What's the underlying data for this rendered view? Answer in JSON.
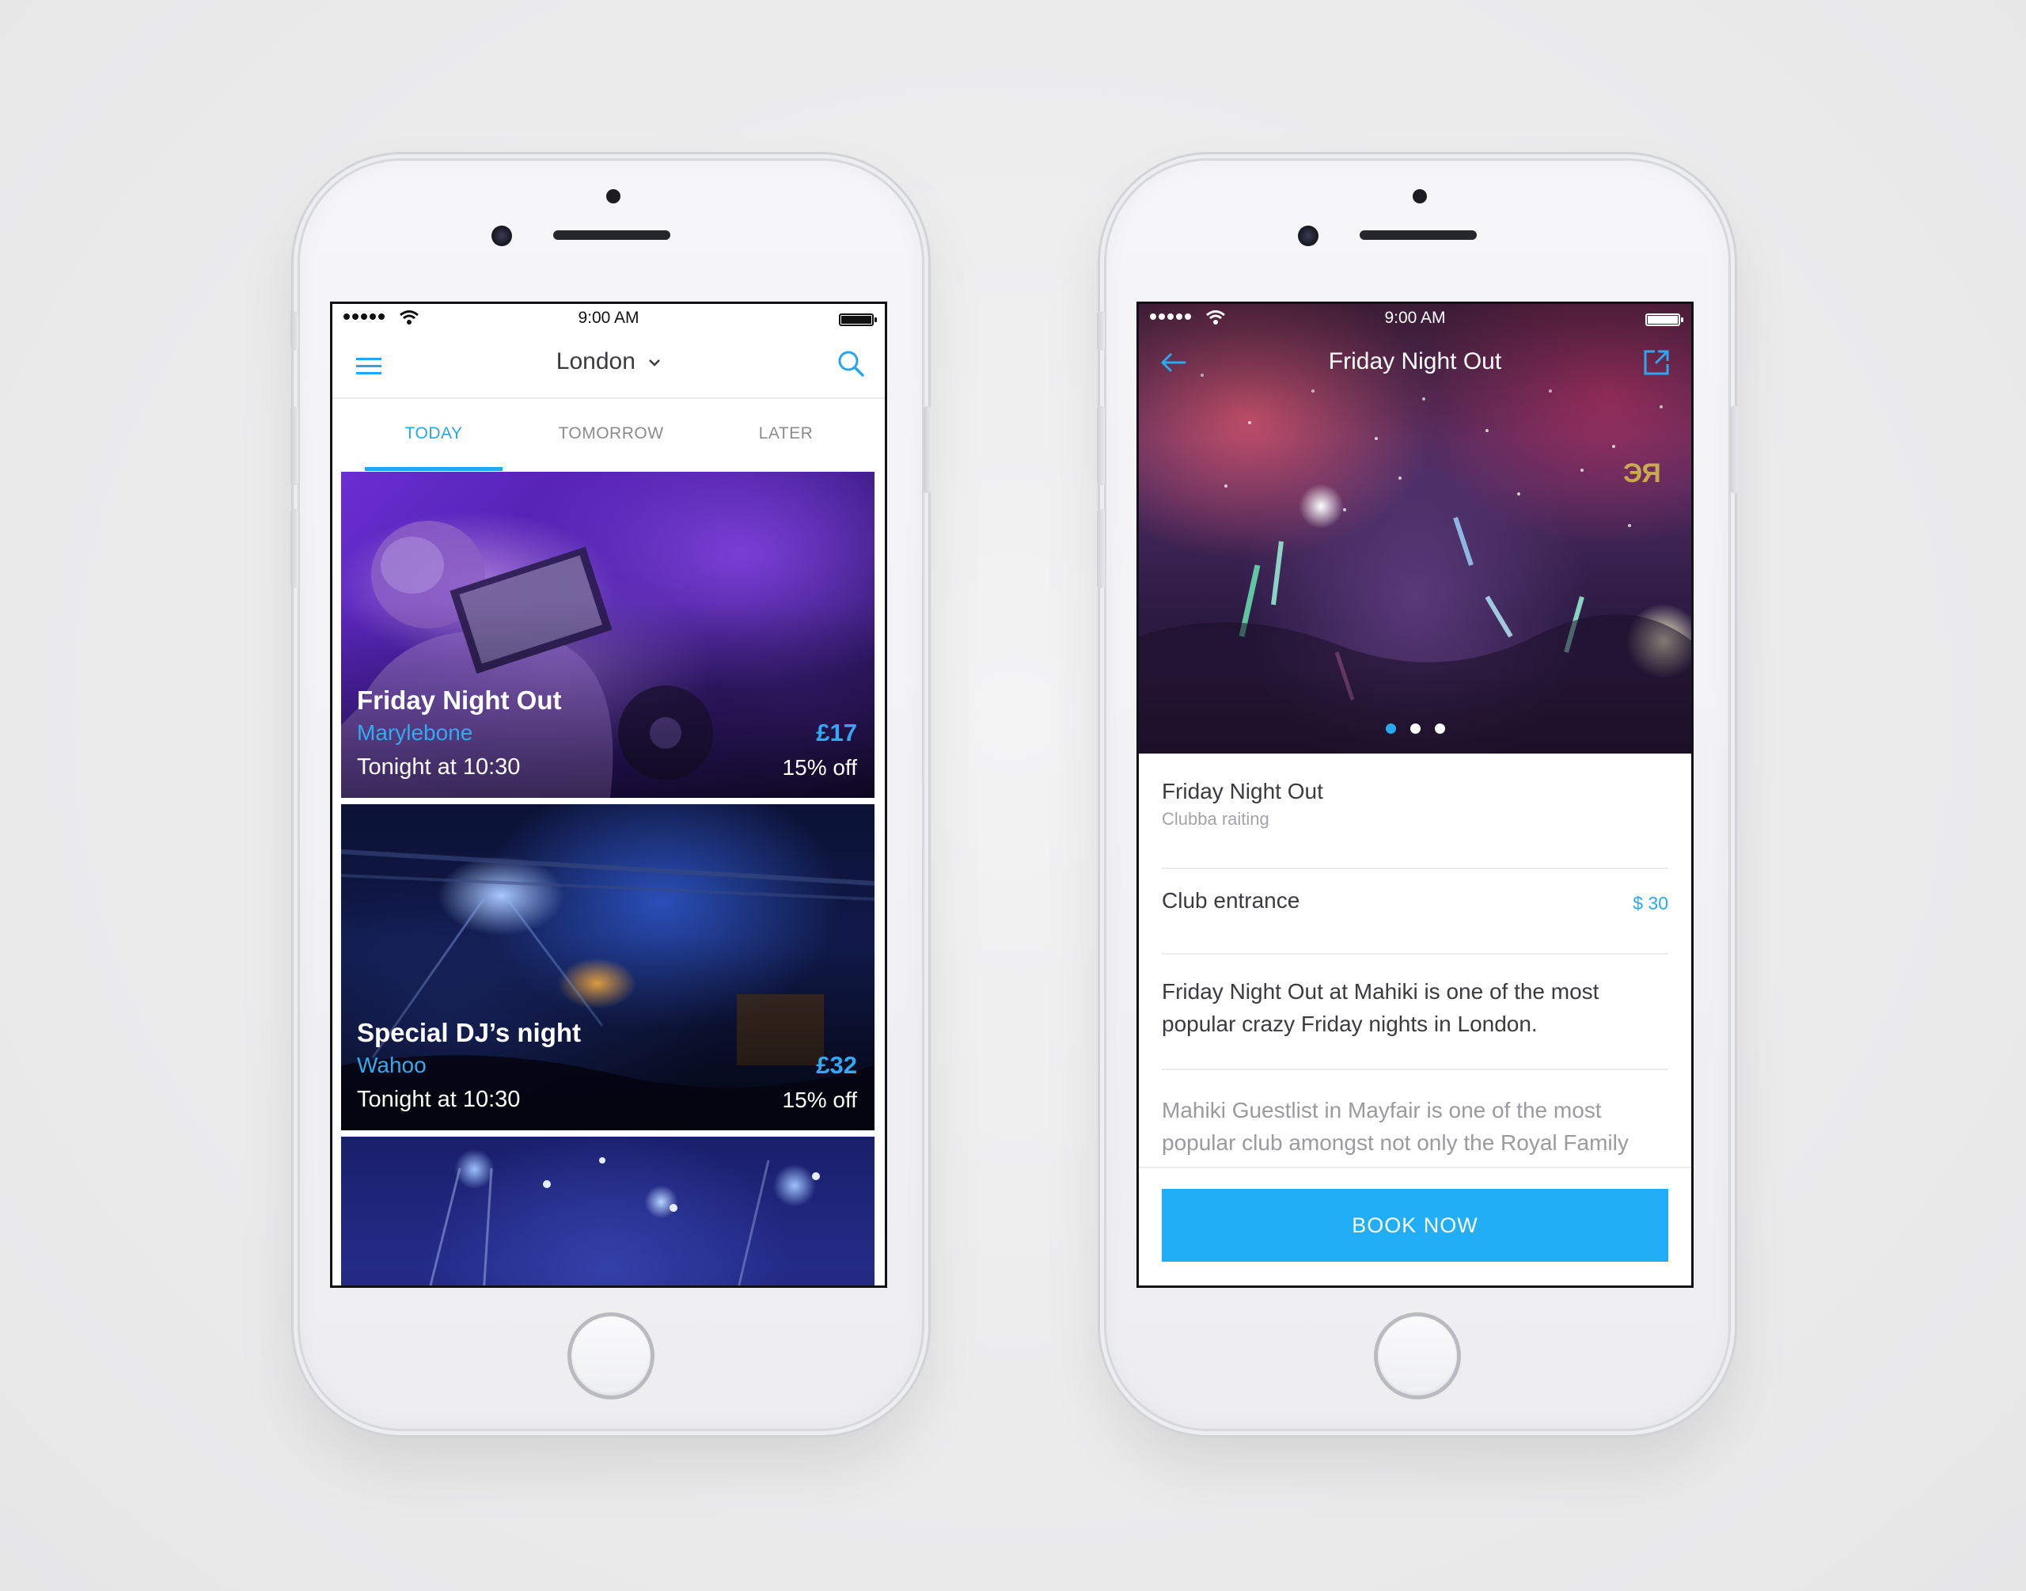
{
  "colors": {
    "accent": "#25a6ee",
    "button": "#22aef7",
    "text_dark": "#3a3b40",
    "text_muted": "#9a9ba1"
  },
  "status_bar": {
    "time": "9:00 AM"
  },
  "list_screen": {
    "city": "London",
    "icons": {
      "menu": "hamburger-menu-icon",
      "dropdown": "chevron-down-icon",
      "search": "search-icon"
    },
    "tabs": [
      {
        "label": "TODAY",
        "active": true
      },
      {
        "label": "TOMORROW",
        "active": false
      },
      {
        "label": "LATER",
        "active": false
      }
    ],
    "events": [
      {
        "title": "Friday Night Out",
        "venue": "Marylebone",
        "time": "Tonight at 10:30",
        "price": "£17",
        "discount": "15% off"
      },
      {
        "title": "Special DJ’s night",
        "venue": "Wahoo",
        "time": "Tonight at 10:30",
        "price": "£32",
        "discount": "15% off"
      }
    ]
  },
  "detail_screen": {
    "title": "Friday Night Out",
    "icons": {
      "back": "back-arrow-icon",
      "share": "share-icon"
    },
    "carousel": {
      "count": 3,
      "active_index": 0
    },
    "event_name": "Friday Night Out",
    "rating_label": "Clubba raiting",
    "entrance_label": "Club entrance",
    "entrance_price": "$ 30",
    "description": "Friday Night Out at Mahiki is one of the most popular crazy Friday nights in London.",
    "extra_description": "Mahiki Guestlist in Mayfair is one of the most popular club amongst not only the Royal Family",
    "book_button": "BOOK NOW"
  }
}
